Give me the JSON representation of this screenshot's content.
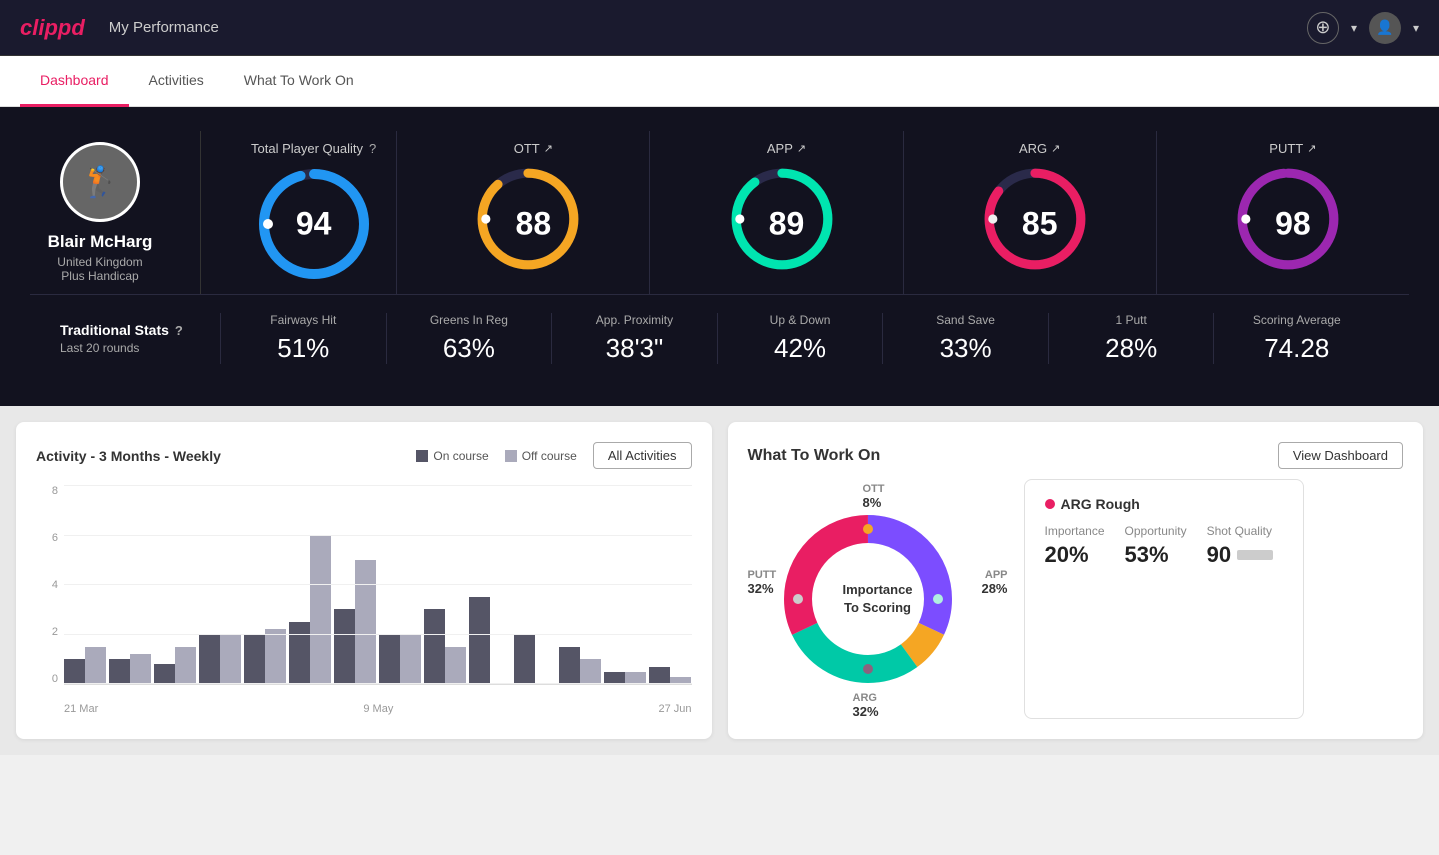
{
  "app": {
    "logo": "clippd",
    "header_title": "My Performance"
  },
  "tabs": [
    {
      "id": "dashboard",
      "label": "Dashboard",
      "active": true
    },
    {
      "id": "activities",
      "label": "Activities",
      "active": false
    },
    {
      "id": "what-to-work-on",
      "label": "What To Work On",
      "active": false
    }
  ],
  "player": {
    "name": "Blair McHarg",
    "country": "United Kingdom",
    "handicap": "Plus Handicap",
    "avatar_emoji": "🏌️"
  },
  "total_quality": {
    "label": "Total Player Quality",
    "value": 94,
    "color": "#2196f3"
  },
  "scores": [
    {
      "id": "ott",
      "label": "OTT",
      "value": 88,
      "color": "#f5a623",
      "arrow": "↗"
    },
    {
      "id": "app",
      "label": "APP",
      "value": 89,
      "color": "#00e5b0",
      "arrow": "↗"
    },
    {
      "id": "arg",
      "label": "ARG",
      "value": 85,
      "color": "#e91e63",
      "arrow": "↗"
    },
    {
      "id": "putt",
      "label": "PUTT",
      "value": 98,
      "color": "#9c27b0",
      "arrow": "↗"
    }
  ],
  "trad_stats": {
    "label": "Traditional Stats",
    "sublabel": "Last 20 rounds",
    "items": [
      {
        "name": "Fairways Hit",
        "value": "51%"
      },
      {
        "name": "Greens In Reg",
        "value": "63%"
      },
      {
        "name": "App. Proximity",
        "value": "38'3\""
      },
      {
        "name": "Up & Down",
        "value": "42%"
      },
      {
        "name": "Sand Save",
        "value": "33%"
      },
      {
        "name": "1 Putt",
        "value": "28%"
      },
      {
        "name": "Scoring Average",
        "value": "74.28"
      }
    ]
  },
  "activity": {
    "title": "Activity - 3 Months - Weekly",
    "legend_on": "On course",
    "legend_off": "Off course",
    "all_btn": "All Activities",
    "x_labels": [
      "21 Mar",
      "9 May",
      "27 Jun"
    ],
    "bars": [
      {
        "on": 1,
        "off": 1.5
      },
      {
        "on": 1,
        "off": 1.2
      },
      {
        "on": 0.8,
        "off": 1.5
      },
      {
        "on": 2,
        "off": 2
      },
      {
        "on": 2,
        "off": 2.2
      },
      {
        "on": 2.5,
        "off": 6
      },
      {
        "on": 3,
        "off": 5
      },
      {
        "on": 2,
        "off": 2
      },
      {
        "on": 3,
        "off": 1.5
      },
      {
        "on": 3.5,
        "off": 0
      },
      {
        "on": 2,
        "off": 0
      },
      {
        "on": 1.5,
        "off": 1
      },
      {
        "on": 0.5,
        "off": 0.5
      },
      {
        "on": 0.7,
        "off": 0.3
      }
    ],
    "y_max": 8
  },
  "work_on": {
    "title": "What To Work On",
    "view_btn": "View Dashboard",
    "donut_center": "Importance\nTo Scoring",
    "segments": [
      {
        "label": "OTT",
        "value": "8%",
        "color": "#f5a623",
        "position": "top"
      },
      {
        "label": "APP",
        "value": "28%",
        "color": "#00c9a7",
        "position": "right"
      },
      {
        "label": "ARG",
        "value": "32%",
        "color": "#e91e63",
        "position": "bottom"
      },
      {
        "label": "PUTT",
        "value": "32%",
        "color": "#7c4dff",
        "position": "left"
      }
    ],
    "info_card": {
      "title": "ARG Rough",
      "dot_color": "#e91e63",
      "metrics": [
        {
          "label": "Importance",
          "value": "20%"
        },
        {
          "label": "Opportunity",
          "value": "53%"
        },
        {
          "label": "Shot Quality",
          "value": "90"
        }
      ]
    }
  },
  "icons": {
    "plus_circle": "⊕",
    "chevron_down": "▾",
    "help": "?",
    "user": "👤"
  }
}
